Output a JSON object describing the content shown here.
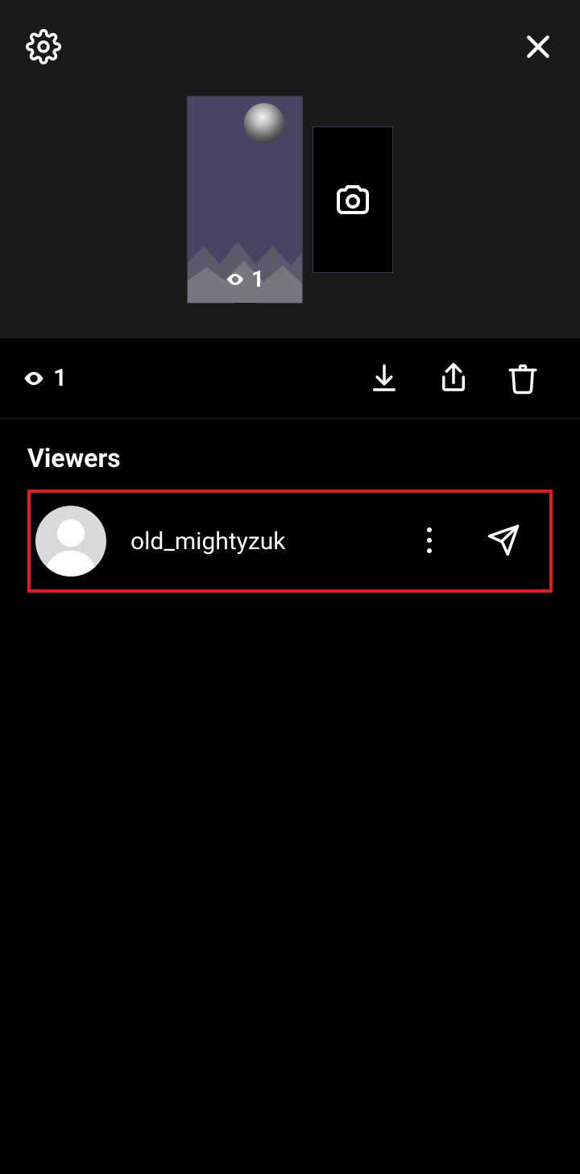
{
  "story": {
    "views_on_thumb": "1"
  },
  "action_bar": {
    "view_count": "1"
  },
  "viewers": {
    "title": "Viewers",
    "list": [
      {
        "username": "old_mightyzuk"
      }
    ]
  }
}
